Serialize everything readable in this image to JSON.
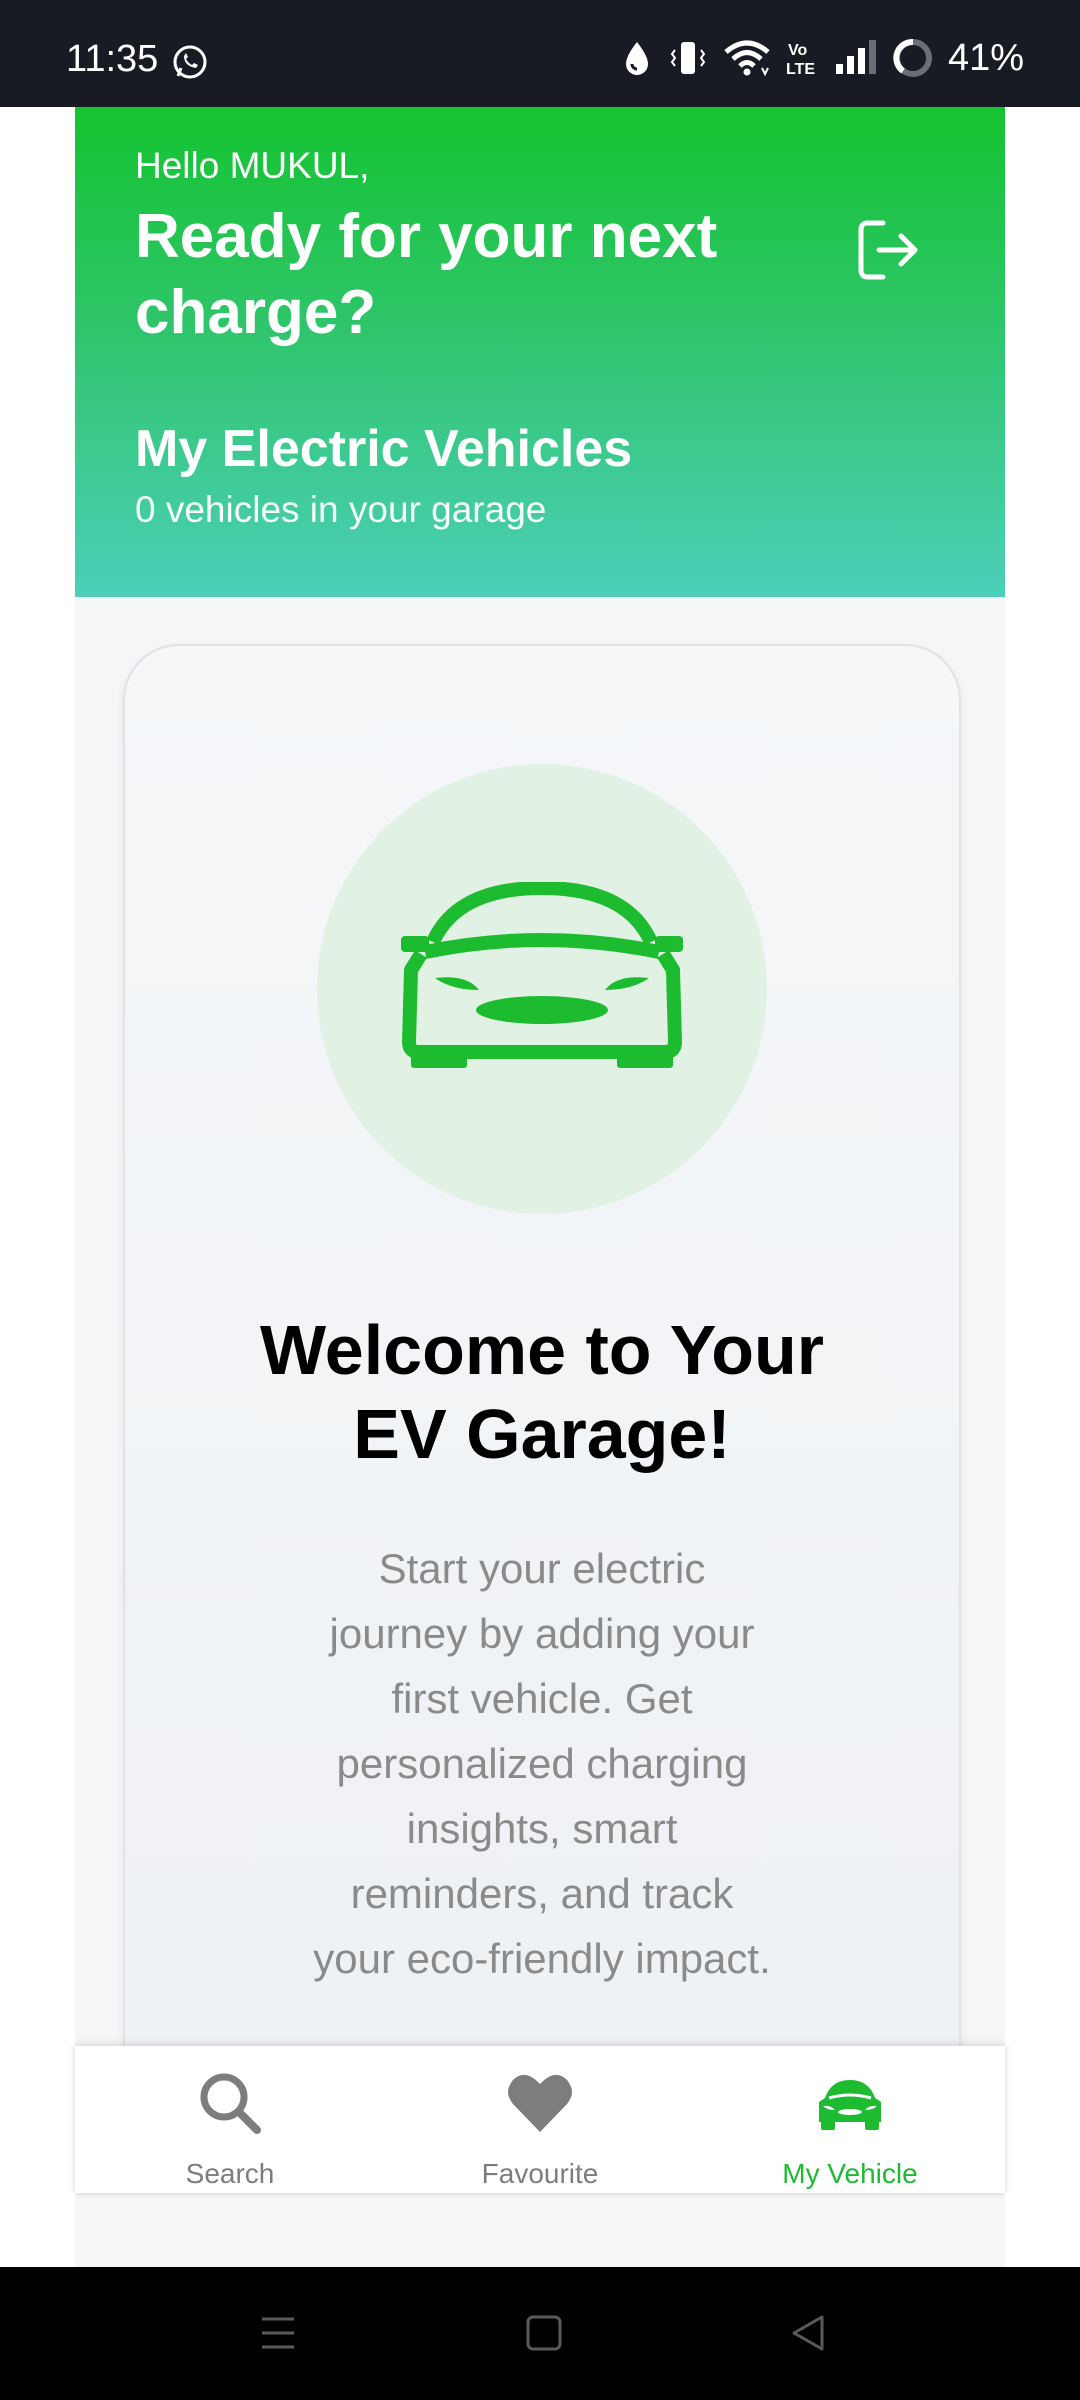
{
  "status_bar": {
    "time": "11:35",
    "battery": "41%",
    "network_label": "Vo LTE",
    "icons": [
      "whatsapp-icon",
      "data-saver-icon",
      "vibrate-icon",
      "wifi-icon",
      "volte-icon",
      "signal-icon",
      "battery-ring-icon"
    ]
  },
  "header": {
    "greeting": "Hello MUKUL,",
    "headline": "Ready for your next charge?",
    "section_title": "My Electric Vehicles",
    "section_subtitle": "0 vehicles in your garage",
    "logout_icon": "logout-icon"
  },
  "empty_state": {
    "title_line1": "Welcome to Your",
    "title_line2": "EV Garage!",
    "body": "Start your electric journey by adding your first vehicle. Get personalized charging insights, smart reminders, and track your eco-friendly impact.",
    "icon": "car-icon"
  },
  "bottom_nav": {
    "items": [
      {
        "label": "Search",
        "icon": "search-icon",
        "active": false
      },
      {
        "label": "Favourite",
        "icon": "heart-icon",
        "active": false
      },
      {
        "label": "My Vehicle",
        "icon": "car-icon",
        "active": true
      }
    ]
  },
  "colors": {
    "brand_green": "#14c430",
    "header_bottom": "#4ccfb9",
    "active_nav": "#1dbb2f",
    "inactive_nav": "#7d7d7d"
  }
}
